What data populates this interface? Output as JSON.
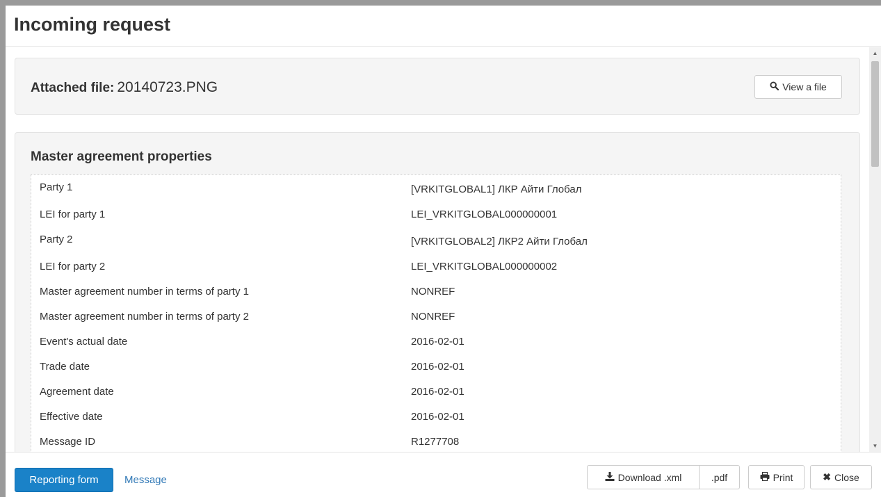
{
  "modal": {
    "title": "Incoming request"
  },
  "file_panel": {
    "label": "Attached file:",
    "file_name": "20140723.PNG",
    "view_button": "View a file"
  },
  "properties": {
    "title": "Master agreement properties",
    "rows": [
      {
        "label": "Party 1",
        "value": "[VRKITGLOBAL1] ЛКР Айти Глобал"
      },
      {
        "label": "LEI for party 1",
        "value": "LEI_VRKITGLOBAL000000001"
      },
      {
        "label": "Party 2",
        "value": "[VRKITGLOBAL2] ЛКР2 Айти Глобал"
      },
      {
        "label": "LEI for party 2",
        "value": "LEI_VRKITGLOBAL000000002"
      },
      {
        "label": "Master agreement number in terms of party 1",
        "value": "NONREF"
      },
      {
        "label": "Master agreement number in terms of party 2",
        "value": "NONREF"
      },
      {
        "label": "Event's actual date",
        "value": "2016-02-01"
      },
      {
        "label": "Trade date",
        "value": "2016-02-01"
      },
      {
        "label": "Agreement date",
        "value": "2016-02-01"
      },
      {
        "label": "Effective date",
        "value": "2016-02-01"
      },
      {
        "label": "Message ID",
        "value": "R1277708"
      }
    ]
  },
  "footer": {
    "reporting_form": "Reporting form",
    "message_link": "Message",
    "download_xml": "Download .xml",
    "download_pdf": ".pdf",
    "print": "Print",
    "close": "Close"
  },
  "colors": {
    "primary": "#1a82c8",
    "link": "#337ab7"
  }
}
